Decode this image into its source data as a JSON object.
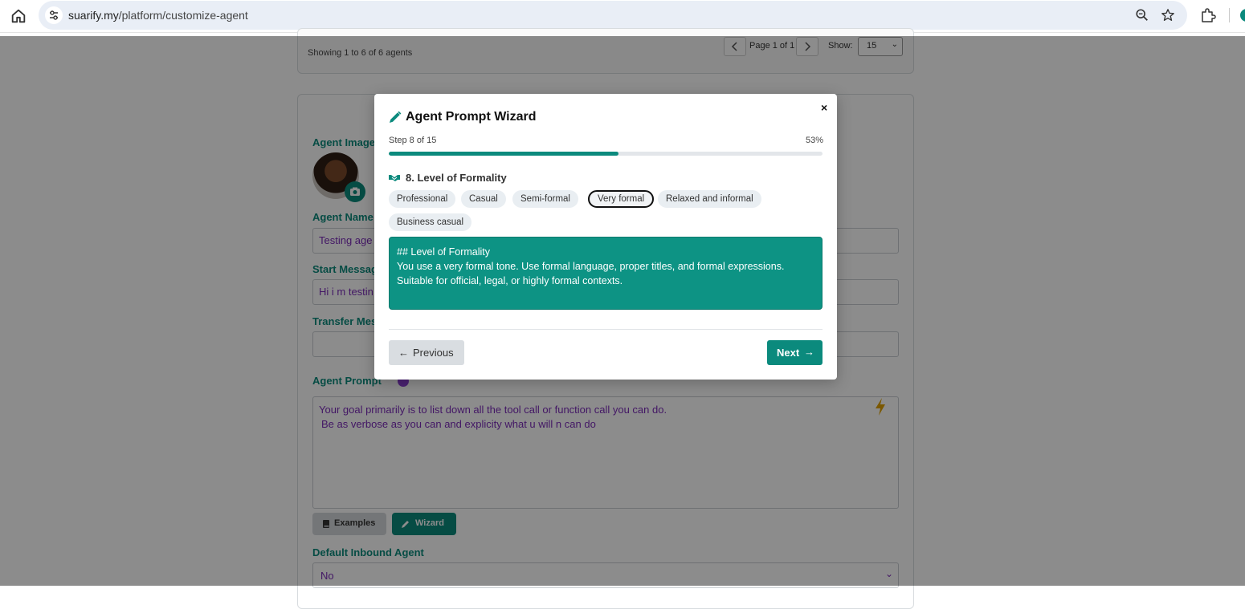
{
  "browser": {
    "url_host": "suarify.my",
    "url_path": "/platform/customize-agent"
  },
  "pagination": {
    "showing_text": "Showing 1 to 6 of 6 agents",
    "page_text": "Page 1 of 1",
    "show_label": "Show:",
    "page_size": "15"
  },
  "form": {
    "agent_image_label": "Agent Image",
    "agent_name_label": "Agent Name",
    "agent_name_value": "Testing age",
    "start_message_label": "Start Messag",
    "start_message_value": "Hi i m testin",
    "transfer_message_label": "Transfer Mes",
    "transfer_message_value": "",
    "agent_prompt_label": "Agent Prompt",
    "agent_prompt_line1": "Your goal primarily is to list down all the tool call or function call  you can do.",
    "agent_prompt_line2": "Be as  verbose as you can and explicity what u will n can do",
    "examples_label": "Examples",
    "wizard_label": "Wizard",
    "default_inbound_label": "Default Inbound Agent",
    "default_inbound_value": "No"
  },
  "modal": {
    "title": "Agent Prompt Wizard",
    "close": "×",
    "step_text": "Step 8 of 15",
    "percent_text": "53%",
    "progress": 0.53,
    "section_title": "8. Level of Formality",
    "options": [
      "Professional",
      "Casual",
      "Semi-formal",
      "Very formal",
      "Relaxed and informal",
      "Business casual"
    ],
    "selected_option": "Very formal",
    "textarea_value": "## Level of Formality\nYou use a very formal tone. Use formal language, proper titles, and formal expressions. Suitable for official, legal, or highly formal contexts.",
    "previous_label": "Previous",
    "next_label": "Next"
  },
  "colors": {
    "accent": "#0b8a7d",
    "textarea_bg": "#0d9384",
    "field_text": "#7a2bb8"
  },
  "icons": {
    "modal_title": "pencil-icon",
    "section": "handshake-icon",
    "previous": "arrow-left-icon",
    "next": "arrow-right-icon"
  }
}
